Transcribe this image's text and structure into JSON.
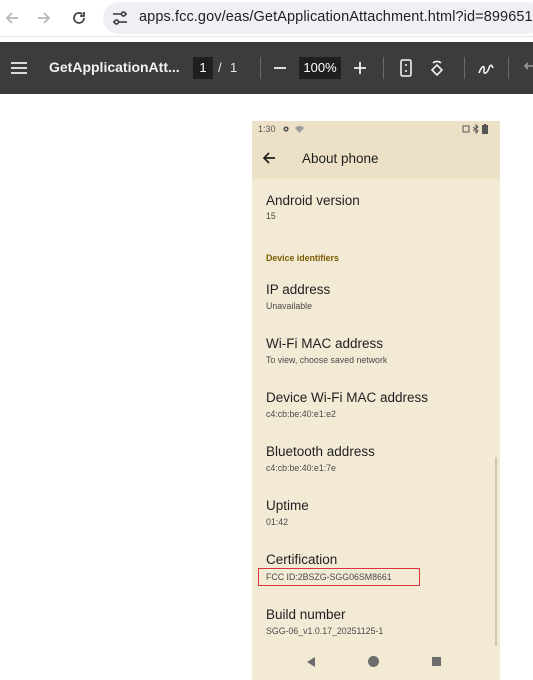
{
  "browser": {
    "url": "apps.fcc.gov/eas/GetApplicationAttachment.html?id=8996514"
  },
  "pdf_toolbar": {
    "title": "GetApplicationAtt...",
    "current_page": "1",
    "page_separator": "/",
    "total_pages": "1",
    "zoom": "100%"
  },
  "phone": {
    "status_time": "1:30",
    "app_title": "About phone",
    "rows": [
      {
        "title": "Android version",
        "value": "15"
      },
      {
        "title": "IP address",
        "value": "Unavailable"
      },
      {
        "title": "Wi-Fi MAC address",
        "value": "To view, choose saved network"
      },
      {
        "title": "Device Wi-Fi MAC address",
        "value": "c4:cb:be:40:e1:e2"
      },
      {
        "title": "Bluetooth address",
        "value": "c4:cb:be:40:e1:7e"
      },
      {
        "title": "Uptime",
        "value": "01:42"
      },
      {
        "title": "Certification",
        "value": "FCC ID:2BSZG-SGG06SM8661"
      },
      {
        "title": "Build number",
        "value": "SGG-06_v1.0.17_20251125-1"
      }
    ],
    "section_label": "Device identifiers"
  },
  "colors": {
    "phone_background": "#f3ead6",
    "appbar_background": "#ece1c6",
    "section_accent": "#7a5b00",
    "highlight_box": "#d9343b",
    "pdf_toolbar_background": "#3c3c3c"
  }
}
